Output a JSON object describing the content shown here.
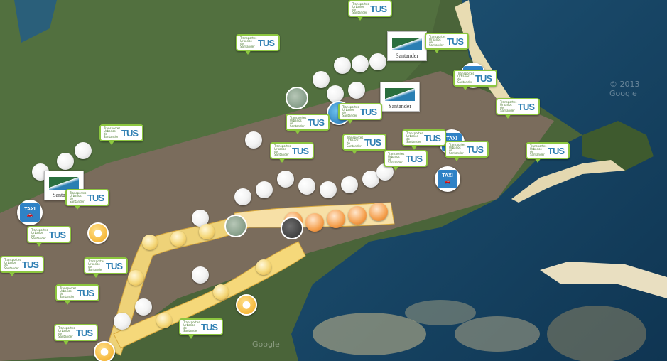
{
  "map": {
    "tus_label": "TUS",
    "tus_small_text": "Transportes Urbanos de Santander",
    "taxi_label": "TAXI",
    "logo_text": "Santander",
    "watermark_1": "© 2013 Google",
    "watermark_2": "Google"
  },
  "colors": {
    "tus_border": "#8cc63f",
    "tus_text": "#2f7fb3",
    "taxi_blue": "#2f82c6",
    "sea": "#1d4f6e",
    "sensor_yellow": "#f5d87a",
    "orange": "#f5a04e"
  }
}
